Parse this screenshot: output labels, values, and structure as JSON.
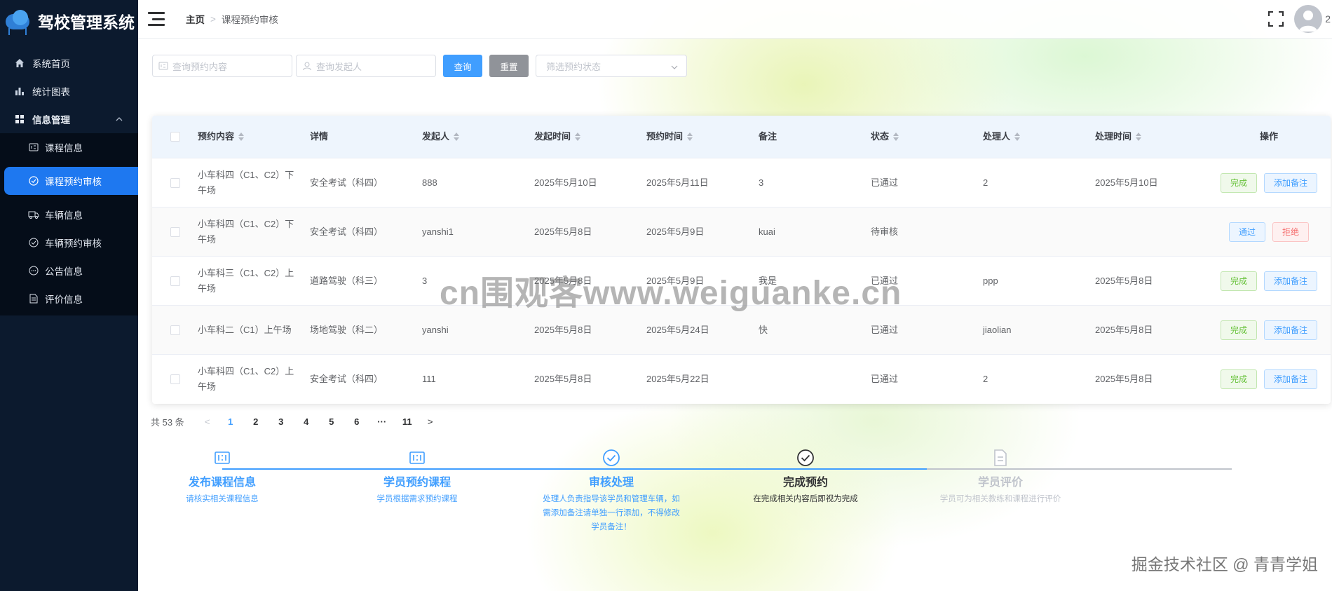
{
  "app": {
    "title": "驾校管理系统"
  },
  "sidebar": {
    "items": [
      {
        "label": "系统首页",
        "icon": "home-icon"
      },
      {
        "label": "统计图表",
        "icon": "bar-chart-icon"
      }
    ],
    "group": {
      "label": "信息管理",
      "icon": "grid-icon",
      "expanded": true,
      "children": [
        {
          "label": "课程信息",
          "icon": "course-icon",
          "active": false
        },
        {
          "label": "课程预约审核",
          "icon": "check-circle-icon",
          "active": true
        },
        {
          "label": "车辆信息",
          "icon": "truck-icon",
          "active": false
        },
        {
          "label": "车辆预约审核",
          "icon": "check-circle-icon",
          "active": false
        },
        {
          "label": "公告信息",
          "icon": "chat-icon",
          "active": false
        },
        {
          "label": "评价信息",
          "icon": "document-icon",
          "active": false
        }
      ]
    }
  },
  "header": {
    "breadcrumb": {
      "home": "主页",
      "current": "课程预约审核"
    },
    "user_name": "2"
  },
  "search": {
    "content_placeholder": "查询预约内容",
    "user_placeholder": "查询发起人",
    "query_label": "查询",
    "reset_label": "重置",
    "status_placeholder": "筛选预约状态"
  },
  "table": {
    "columns": {
      "content": "预约内容",
      "detail": "详情",
      "user": "发起人",
      "start_time": "发起时间",
      "appt_time": "预约时间",
      "note": "备注",
      "status": "状态",
      "handler": "处理人",
      "handle_time": "处理时间",
      "ops": "操作"
    },
    "rows": [
      {
        "content": "小车科四（C1、C2）下午场",
        "detail": "安全考试（科四）",
        "user": "888",
        "start_time": "2025年5月10日",
        "appt_time": "2025年5月11日",
        "note": "3",
        "status": "已通过",
        "handler": "2",
        "handle_time": "2025年5月10日",
        "op1": "完成",
        "op2": "添加备注",
        "op_type": "approved"
      },
      {
        "content": "小车科四（C1、C2）下午场",
        "detail": "安全考试（科四）",
        "user": "yanshi1",
        "start_time": "2025年5月8日",
        "appt_time": "2025年5月9日",
        "note": "kuai",
        "status": "待审核",
        "handler": "",
        "handle_time": "",
        "op1": "通过",
        "op2": "拒绝",
        "op_type": "pending"
      },
      {
        "content": "小车科三（C1、C2）上午场",
        "detail": "道路驾驶（科三）",
        "user": "3",
        "start_time": "2025年5月8日",
        "appt_time": "2025年5月9日",
        "note": "我是",
        "status": "已通过",
        "handler": "ppp",
        "handle_time": "2025年5月8日",
        "op1": "完成",
        "op2": "添加备注",
        "op_type": "approved"
      },
      {
        "content": "小车科二（C1）上午场",
        "detail": "场地驾驶（科二）",
        "user": "yanshi",
        "start_time": "2025年5月8日",
        "appt_time": "2025年5月24日",
        "note": "快",
        "status": "已通过",
        "handler": "jiaolian",
        "handle_time": "2025年5月8日",
        "op1": "完成",
        "op2": "添加备注",
        "op_type": "approved"
      },
      {
        "content": "小车科四（C1、C2）上午场",
        "detail": "安全考试（科四）",
        "user": "111",
        "start_time": "2025年5月8日",
        "appt_time": "2025年5月22日",
        "note": "",
        "status": "已通过",
        "handler": "2",
        "handle_time": "2025年5月8日",
        "op1": "完成",
        "op2": "添加备注",
        "op_type": "approved"
      }
    ]
  },
  "pagination": {
    "total_label": "共 53 条",
    "pages": [
      "1",
      "2",
      "3",
      "4",
      "5",
      "6",
      "···",
      "11"
    ],
    "current": "1"
  },
  "steps": [
    {
      "title": "发布课程信息",
      "desc": "请核实相关课程信息",
      "state": "done",
      "icon": "form-icon"
    },
    {
      "title": "学员预约课程",
      "desc": "学员根据需求预约课程",
      "state": "done",
      "icon": "form-icon"
    },
    {
      "title": "审核处理",
      "desc": "处理人负责指导该学员和管理车辆，如需添加备注请单独一行添加，不得修改学员备注！",
      "state": "done",
      "icon": "check-circle-icon"
    },
    {
      "title": "完成预约",
      "desc": "在完成相关内容后即视为完成",
      "state": "process",
      "icon": "check-circle-icon"
    },
    {
      "title": "学员评价",
      "desc": "学员可为相关教练和课程进行评价",
      "state": "wait",
      "icon": "document-icon"
    }
  ],
  "watermarks": {
    "center": "cn围观客www.weiguanke.cn",
    "corner": "掘金技术社区 @ 青青学姐"
  },
  "colors": {
    "sidebar_bg": "#0c1a2e",
    "active": "#1e78f0",
    "primary": "#409eff",
    "success": "#67c23a",
    "danger": "#f56c6c"
  }
}
